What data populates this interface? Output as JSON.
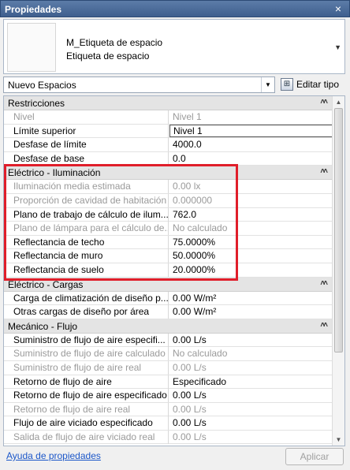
{
  "window": {
    "title": "Propiedades",
    "close_glyph": "×"
  },
  "type_selector": {
    "family": "M_Etiqueta de espacio",
    "type": "Etiqueta de espacio",
    "arrow_icon": "chevron-down-icon"
  },
  "instance_filter": {
    "value": "Nuevo Espacios",
    "dropdown_glyph": "▼"
  },
  "edit_type": {
    "label": "Editar tipo"
  },
  "groups": [
    {
      "name": "Restricciones",
      "rows": [
        {
          "label": "Nivel",
          "value": "Nivel 1",
          "disabled": true
        },
        {
          "label": "Límite superior",
          "value": "Nivel 1",
          "disabled": false
        },
        {
          "label": "Desfase de límite",
          "value": "4000.0",
          "disabled": false
        },
        {
          "label": "Desfase de base",
          "value": "0.0",
          "disabled": false
        }
      ]
    },
    {
      "name": "Eléctrico - Iluminación",
      "rows": [
        {
          "label": "Iluminación media estimada",
          "value": "0.00 lx",
          "disabled": true
        },
        {
          "label": "Proporción de cavidad de habitación",
          "value": "0.000000",
          "disabled": true
        },
        {
          "label": "Plano de trabajo de cálculo de ilum...",
          "value": "762.0",
          "disabled": false
        },
        {
          "label": "Plano de lámpara para el cálculo de...",
          "value": "No calculado",
          "disabled": true
        },
        {
          "label": "Reflectancia de techo",
          "value": "75.0000%",
          "disabled": false
        },
        {
          "label": "Reflectancia de muro",
          "value": "50.0000%",
          "disabled": false
        },
        {
          "label": "Reflectancia de suelo",
          "value": "20.0000%",
          "disabled": false
        }
      ]
    },
    {
      "name": "Eléctrico - Cargas",
      "rows": [
        {
          "label": "Carga de climatización de diseño p...",
          "value": "0.00 W/m²",
          "disabled": false
        },
        {
          "label": "Otras cargas de diseño por área",
          "value": "0.00 W/m²",
          "disabled": false
        }
      ]
    },
    {
      "name": "Mecánico - Flujo",
      "rows": [
        {
          "label": "Suministro de flujo de aire especifi...",
          "value": "0.00 L/s",
          "disabled": false
        },
        {
          "label": "Suministro de flujo de aire calculado",
          "value": "No calculado",
          "disabled": true
        },
        {
          "label": "Suministro de flujo de aire real",
          "value": "0.00 L/s",
          "disabled": true
        },
        {
          "label": "Retorno de flujo de aire",
          "value": "Especificado",
          "disabled": false
        },
        {
          "label": "Retorno de flujo de aire especificado",
          "value": "0.00 L/s",
          "disabled": false
        },
        {
          "label": "Retorno de flujo de aire real",
          "value": "0.00 L/s",
          "disabled": true
        },
        {
          "label": "Flujo de aire viciado especificado",
          "value": "0.00 L/s",
          "disabled": false
        },
        {
          "label": "Salida de flujo de aire viciado real",
          "value": "0.00 L/s",
          "disabled": true
        }
      ]
    }
  ],
  "footer": {
    "help_link": "Ayuda de propiedades",
    "apply_label": "Aplicar"
  },
  "colors": {
    "highlight": "#e01e2a",
    "titlebar": "#4a6a98",
    "link": "#1c57c9"
  }
}
